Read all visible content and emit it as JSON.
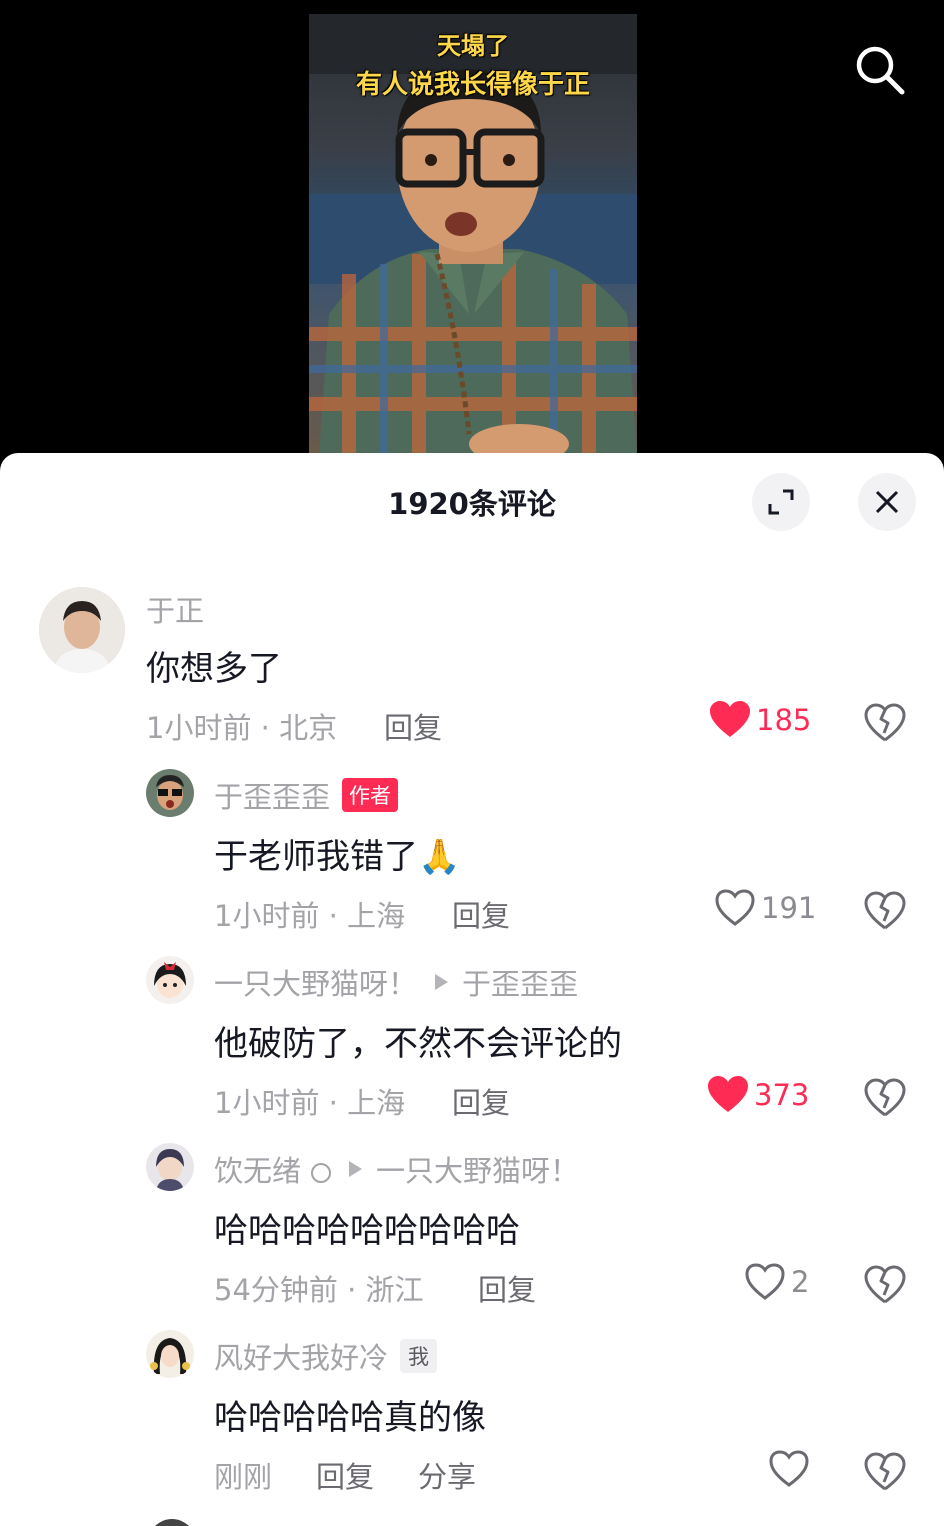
{
  "video": {
    "caption_line1": "天塌了",
    "caption_line2": "有人说我长得像于正"
  },
  "sheet": {
    "title": "1920条评论"
  },
  "comments": [
    {
      "user": "于正",
      "text": "你想多了",
      "time_location": "1小时前 · 北京",
      "reply_label": "回复",
      "likes": "185",
      "liked": true
    },
    {
      "user": "于歪歪歪",
      "tag": "作者",
      "text": "于老师我错了🙏",
      "time_location": "1小时前 · 上海",
      "reply_label": "回复",
      "likes": "191",
      "liked": false
    },
    {
      "user": "一只大野猫呀！",
      "reply_to": "于歪歪歪",
      "text": "他破防了，不然不会评论的",
      "time_location": "1小时前 · 上海",
      "reply_label": "回复",
      "likes": "373",
      "liked": true
    },
    {
      "user": "饮无绪",
      "reply_to": "一只大野猫呀！",
      "text": "哈哈哈哈哈哈哈哈哈",
      "time_location": "54分钟前 · 浙江",
      "reply_label": "回复",
      "likes": "2",
      "liked": false
    },
    {
      "user": "风好大我好冷",
      "tag": "我",
      "text": "哈哈哈哈哈真的像",
      "time_location": "刚刚",
      "reply_label": "回复",
      "share_label": "分享",
      "likes": "",
      "liked": false
    }
  ],
  "colors": {
    "accent": "#fe2c55",
    "secondary_text": "#a3a3a8",
    "primary_text": "#161823"
  }
}
